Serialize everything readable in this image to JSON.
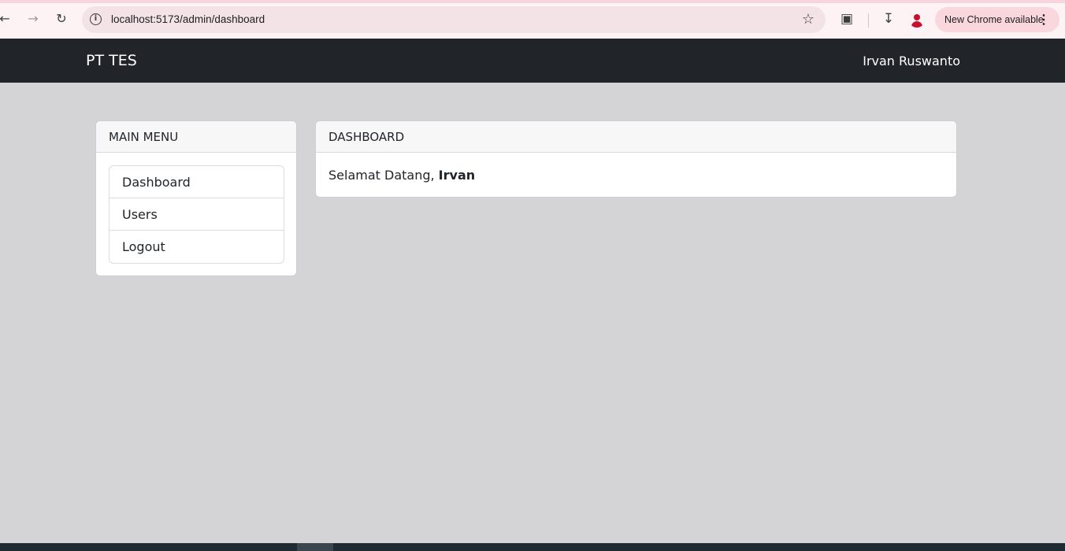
{
  "browser": {
    "url": "localhost:5173/admin/dashboard",
    "update_label": "New Chrome available"
  },
  "navbar": {
    "brand": "PT TES",
    "user_name": "Irvan Ruswanto"
  },
  "sidebar": {
    "title": "MAIN MENU",
    "items": [
      {
        "label": "Dashboard"
      },
      {
        "label": "Users"
      },
      {
        "label": "Logout"
      }
    ]
  },
  "dashboard": {
    "title": "DASHBOARD",
    "greeting": "Selamat Datang, ",
    "user_first_name": "Irvan"
  }
}
